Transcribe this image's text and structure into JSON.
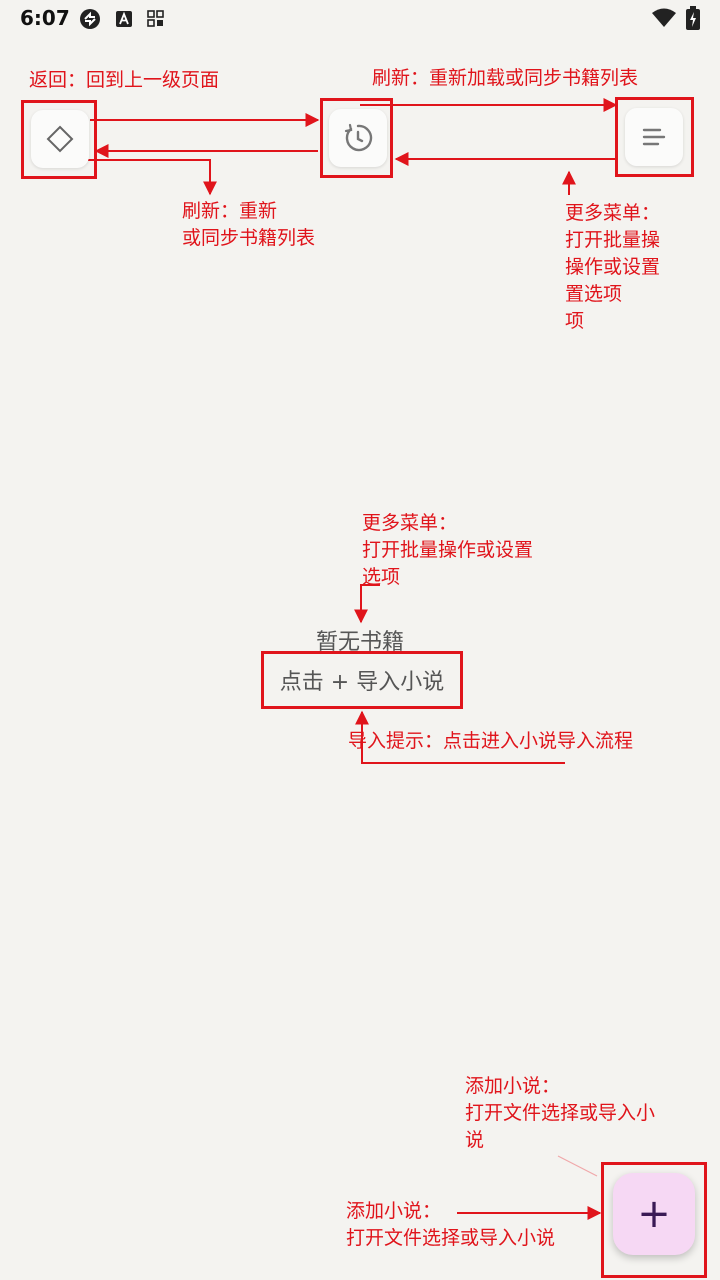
{
  "status_bar": {
    "time": "6:07"
  },
  "colors": {
    "annotation": "#e0141b",
    "fab_bg": "#f6d8f4",
    "background": "#f4f3f0"
  },
  "toolbar": {
    "back_icon": "diamond-icon",
    "refresh_icon": "refresh-icon",
    "menu_icon": "menu-lines-icon"
  },
  "annotations": {
    "back": "返回：回到上一级页面",
    "refresh_top": "刷新：重新加载或同步书籍列表",
    "refresh_mid_1": "刷新：重新",
    "refresh_mid_2": "或同步书籍列表",
    "menu_right_1": "更多菜单：",
    "menu_right_2": "打开批量操",
    "menu_right_3": "操作或设置",
    "menu_right_4": "置选项",
    "menu_right_5": "项",
    "menu_center_1": "更多菜单：",
    "menu_center_2": "打开批量操作或设置",
    "menu_center_3": "选项",
    "import_tip": "导入提示：点击进入小说导入流程",
    "add_top_1": "添加小说：",
    "add_top_2": "打开文件选择或导入小",
    "add_top_3": "说",
    "add_bottom_1": "添加小说：",
    "add_bottom_2": "打开文件选择或导入小说"
  },
  "empty_state": {
    "title": "暂无书籍",
    "hint": "点击 + 导入小说"
  },
  "fab": {
    "label": "+"
  }
}
